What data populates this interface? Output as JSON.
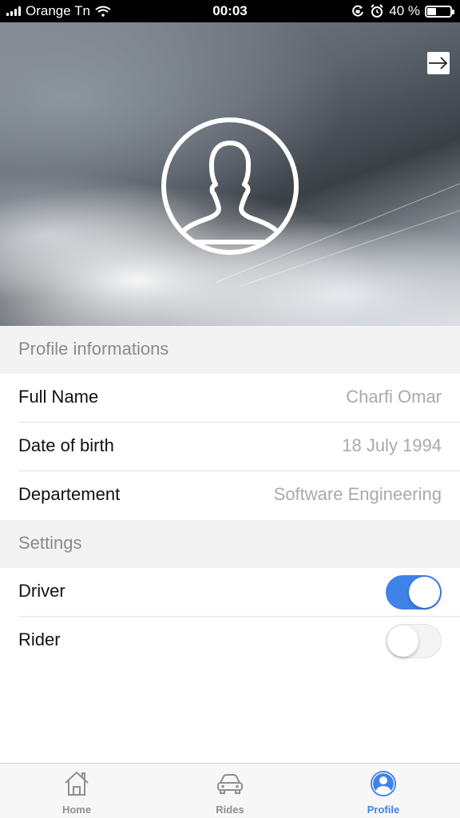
{
  "status_bar": {
    "carrier": "Orange Tn",
    "time": "00:03",
    "battery_percent": "40 %",
    "battery_level": 0.4,
    "icons": [
      "signal-icon",
      "wifi-icon",
      "orientation-lock-icon",
      "alarm-icon",
      "battery-icon"
    ]
  },
  "header": {
    "logout_icon": "logout-arrow-icon",
    "avatar_icon": "user-silhouette-icon"
  },
  "profile": {
    "section_title": "Profile informations",
    "rows": [
      {
        "label": "Full Name",
        "value": "Charfi Omar"
      },
      {
        "label": "Date of birth",
        "value": "18 July 1994"
      },
      {
        "label": "Departement",
        "value": "Software Engineering"
      }
    ]
  },
  "settings": {
    "section_title": "Settings",
    "toggles": [
      {
        "label": "Driver",
        "on": true
      },
      {
        "label": "Rider",
        "on": false
      }
    ]
  },
  "tab_bar": {
    "tabs": [
      {
        "label": "Home",
        "icon": "home-icon",
        "active": false
      },
      {
        "label": "Rides",
        "icon": "car-icon",
        "active": false
      },
      {
        "label": "Profile",
        "icon": "profile-icon",
        "active": true
      }
    ]
  },
  "colors": {
    "accent": "#3f82e8",
    "section_bg": "#f3f3f3",
    "value_text": "#a9a9b1",
    "inactive_tab": "#8e8e93"
  }
}
